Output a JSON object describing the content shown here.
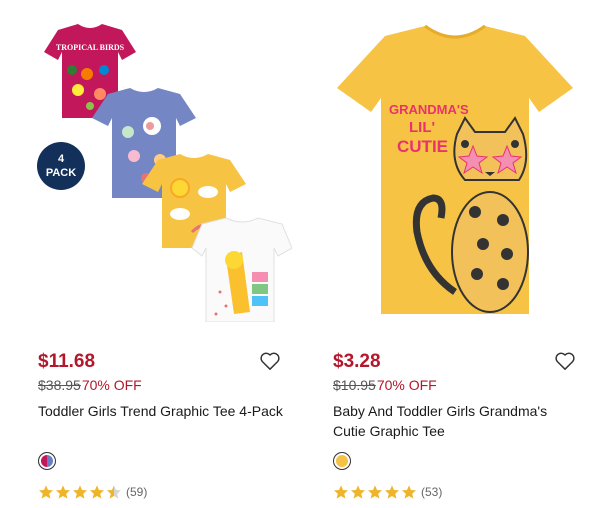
{
  "products": [
    {
      "badge": "4 PACK",
      "shirt_text": "TROPICAL BIRDS",
      "price": "$11.68",
      "original_price": "$38.95",
      "discount": "70% OFF",
      "title": "Toddler Girls Trend Graphic Tee 4-Pack",
      "swatch_colors": [
        "#c2185b",
        "#6a7fc1"
      ],
      "rating": 4.5,
      "review_count": "(59)"
    },
    {
      "shirt_text": [
        "GRANDMA'S",
        "LIL'",
        "CUTIE"
      ],
      "price": "$3.28",
      "original_price": "$10.95",
      "discount": "70% OFF",
      "title": "Baby And Toddler Girls Grandma's Cutie Graphic Tee",
      "swatch_colors": [
        "#f4c244"
      ],
      "rating": 5,
      "review_count": "(53)"
    }
  ],
  "colors": {
    "price_red": "#b3172b",
    "star_gold": "#f0b429",
    "badge_navy": "#13305a"
  },
  "icons": {
    "favorite": "heart-outline-icon",
    "rating": "star-icon"
  }
}
